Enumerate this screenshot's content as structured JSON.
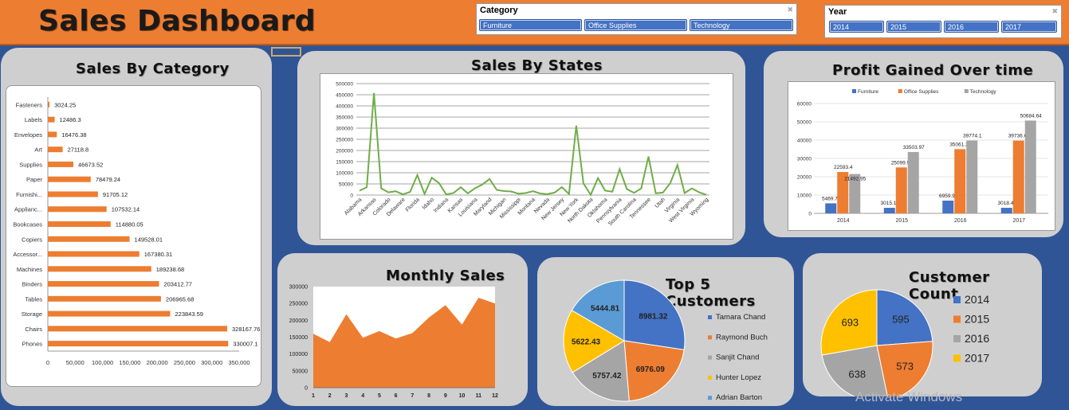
{
  "header": {
    "title": "Sales Dashboard"
  },
  "slicers": {
    "category": {
      "title": "Category",
      "options": [
        "Furniture",
        "Office Supplies",
        "Technology"
      ]
    },
    "year": {
      "title": "Year",
      "options": [
        "2014",
        "2015",
        "2016",
        "2017"
      ]
    }
  },
  "panels": {
    "sales_by_category": "Sales By Category",
    "sales_by_states": "Sales By States",
    "profit_over_time": "Profit Gained Over time",
    "monthly_sales": "Monthly Sales",
    "top_customers": "Top 5 Customers",
    "customer_count": "Customer Count"
  },
  "colors": {
    "orange": "#ed7d31",
    "blue": "#4472c4",
    "gray": "#a5a5a5",
    "yellow": "#ffc000",
    "light_blue": "#5b9bd5",
    "green": "#70ad47"
  },
  "watermark": "Activate Windows",
  "chart_data": [
    {
      "id": "sales_by_category",
      "type": "bar",
      "orientation": "horizontal",
      "categories": [
        "Fasteners",
        "Labels",
        "Envelopes",
        "Art",
        "Supplies",
        "Paper",
        "Furnishi...",
        "Applianc...",
        "Bookcases",
        "Copiers",
        "Accessor...",
        "Machines",
        "Binders",
        "Tables",
        "Storage",
        "Chairs",
        "Phones"
      ],
      "values": [
        3024.25,
        12486.3,
        16476.38,
        27118.8,
        46673.52,
        78479.24,
        91705.12,
        107532.14,
        114880.05,
        149528.01,
        167380.31,
        189238.68,
        203412.77,
        206965.68,
        223843.59,
        328167.76,
        330007.1
      ],
      "labels": [
        "3024.25",
        "12486.3",
        "16476.38",
        "27118.8",
        "46673.52",
        "78479.24",
        "91705.12",
        "107532.14",
        "114880.05",
        "149528.01",
        "167380.31",
        "189238.68",
        "203412.77",
        "206965.68",
        "223843.59",
        "328167.76",
        "330007.1"
      ],
      "xticks": [
        "0",
        "50,000",
        "100,000",
        "150,000",
        "200,000",
        "250,000",
        "300,000",
        "350,000"
      ],
      "xlim": [
        0,
        350000
      ]
    },
    {
      "id": "sales_by_states",
      "type": "line",
      "x": [
        "Alabama",
        "Arkansas",
        "Colorado",
        "Delaware",
        "Florida",
        "Idaho",
        "Indiana",
        "Kansas",
        "Louisiana",
        "Maryland",
        "Michigan",
        "Mississippi",
        "Montana",
        "Nevada",
        "New Jersey",
        "New York",
        "North Dakota",
        "Oklahoma",
        "Pennsylvania",
        "South Carolina",
        "Tennessee",
        "Utah",
        "Virginia",
        "West Virginia",
        "Wyoming"
      ],
      "values": [
        19511,
        35282,
        457688,
        30000,
        12000,
        17000,
        3000,
        14000,
        89474,
        5000,
        78000,
        53555,
        2500,
        9000,
        35000,
        8000,
        31000,
        47000,
        72000,
        23000,
        18000,
        16000,
        6000,
        9000,
        17000,
        7000,
        4000,
        11000,
        35219,
        5000,
        311000,
        52000,
        920,
        76000,
        20000,
        15000,
        116500,
        27000,
        10000,
        30000,
        173000,
        8000,
        11000,
        53000,
        135000,
        9000,
        30000,
        13000,
        1000
      ],
      "yticks": [
        "0",
        "50000",
        "100000",
        "150000",
        "200000",
        "250000",
        "300000",
        "350000",
        "400000",
        "450000",
        "500000"
      ],
      "ylim": [
        0,
        500000
      ]
    },
    {
      "id": "profit_over_time",
      "type": "bar",
      "categories": [
        "2014",
        "2015",
        "2016",
        "2017"
      ],
      "series": [
        {
          "name": "Furniture",
          "values": [
            5469.77,
            3015.17,
            6959.93,
            3018.44
          ],
          "labels": [
            "5469.77",
            "3015.17",
            "6959.93",
            "3018.44"
          ]
        },
        {
          "name": "Office Supplies",
          "values": [
            22593.4,
            25099.55,
            35061.24,
            39736.69
          ],
          "labels": [
            "22593.4",
            "25099.55",
            "35061.24",
            "39736.69"
          ]
        },
        {
          "name": "Technology",
          "values": [
            21492.95,
            33503.97,
            39774.1,
            50684.64
          ],
          "labels": [
            "21492.95",
            "33503.97",
            "39774.1",
            "50684.64"
          ]
        }
      ],
      "yticks": [
        "0",
        "10000",
        "20000",
        "30000",
        "40000",
        "50000",
        "60000"
      ],
      "ylim": [
        0,
        60000
      ],
      "legend": "top"
    },
    {
      "id": "monthly_sales",
      "type": "area",
      "x": [
        "1",
        "2",
        "3",
        "4",
        "5",
        "6",
        "7",
        "8",
        "9",
        "10",
        "11",
        "12"
      ],
      "values": [
        160000,
        135000,
        218000,
        148000,
        168000,
        146000,
        162000,
        208000,
        245000,
        187000,
        267000,
        250000
      ],
      "yticks": [
        "0",
        "50000",
        "100000",
        "150000",
        "200000",
        "250000",
        "300000"
      ],
      "ylim": [
        0,
        300000
      ]
    },
    {
      "id": "top_customers",
      "type": "pie",
      "labels": [
        "Tamara Chand",
        "Raymond Buch",
        "Sanjit Chand",
        "Hunter Lopez",
        "Adrian Barton"
      ],
      "values": [
        8981.32,
        6976.09,
        5757.42,
        5622.43,
        5444.81
      ],
      "value_labels": [
        "8981.32",
        "6976.09",
        "5757.42",
        "5622.43",
        "5444.81"
      ],
      "colors": [
        "#4472c4",
        "#ed7d31",
        "#a5a5a5",
        "#ffc000",
        "#5b9bd5"
      ],
      "legend": "right"
    },
    {
      "id": "customer_count",
      "type": "pie",
      "labels": [
        "2014",
        "2015",
        "2016",
        "2017"
      ],
      "values": [
        595,
        573,
        638,
        693
      ],
      "value_labels": [
        "595",
        "573",
        "638",
        "693"
      ],
      "colors": [
        "#4472c4",
        "#ed7d31",
        "#a5a5a5",
        "#ffc000"
      ],
      "legend": "right"
    }
  ]
}
